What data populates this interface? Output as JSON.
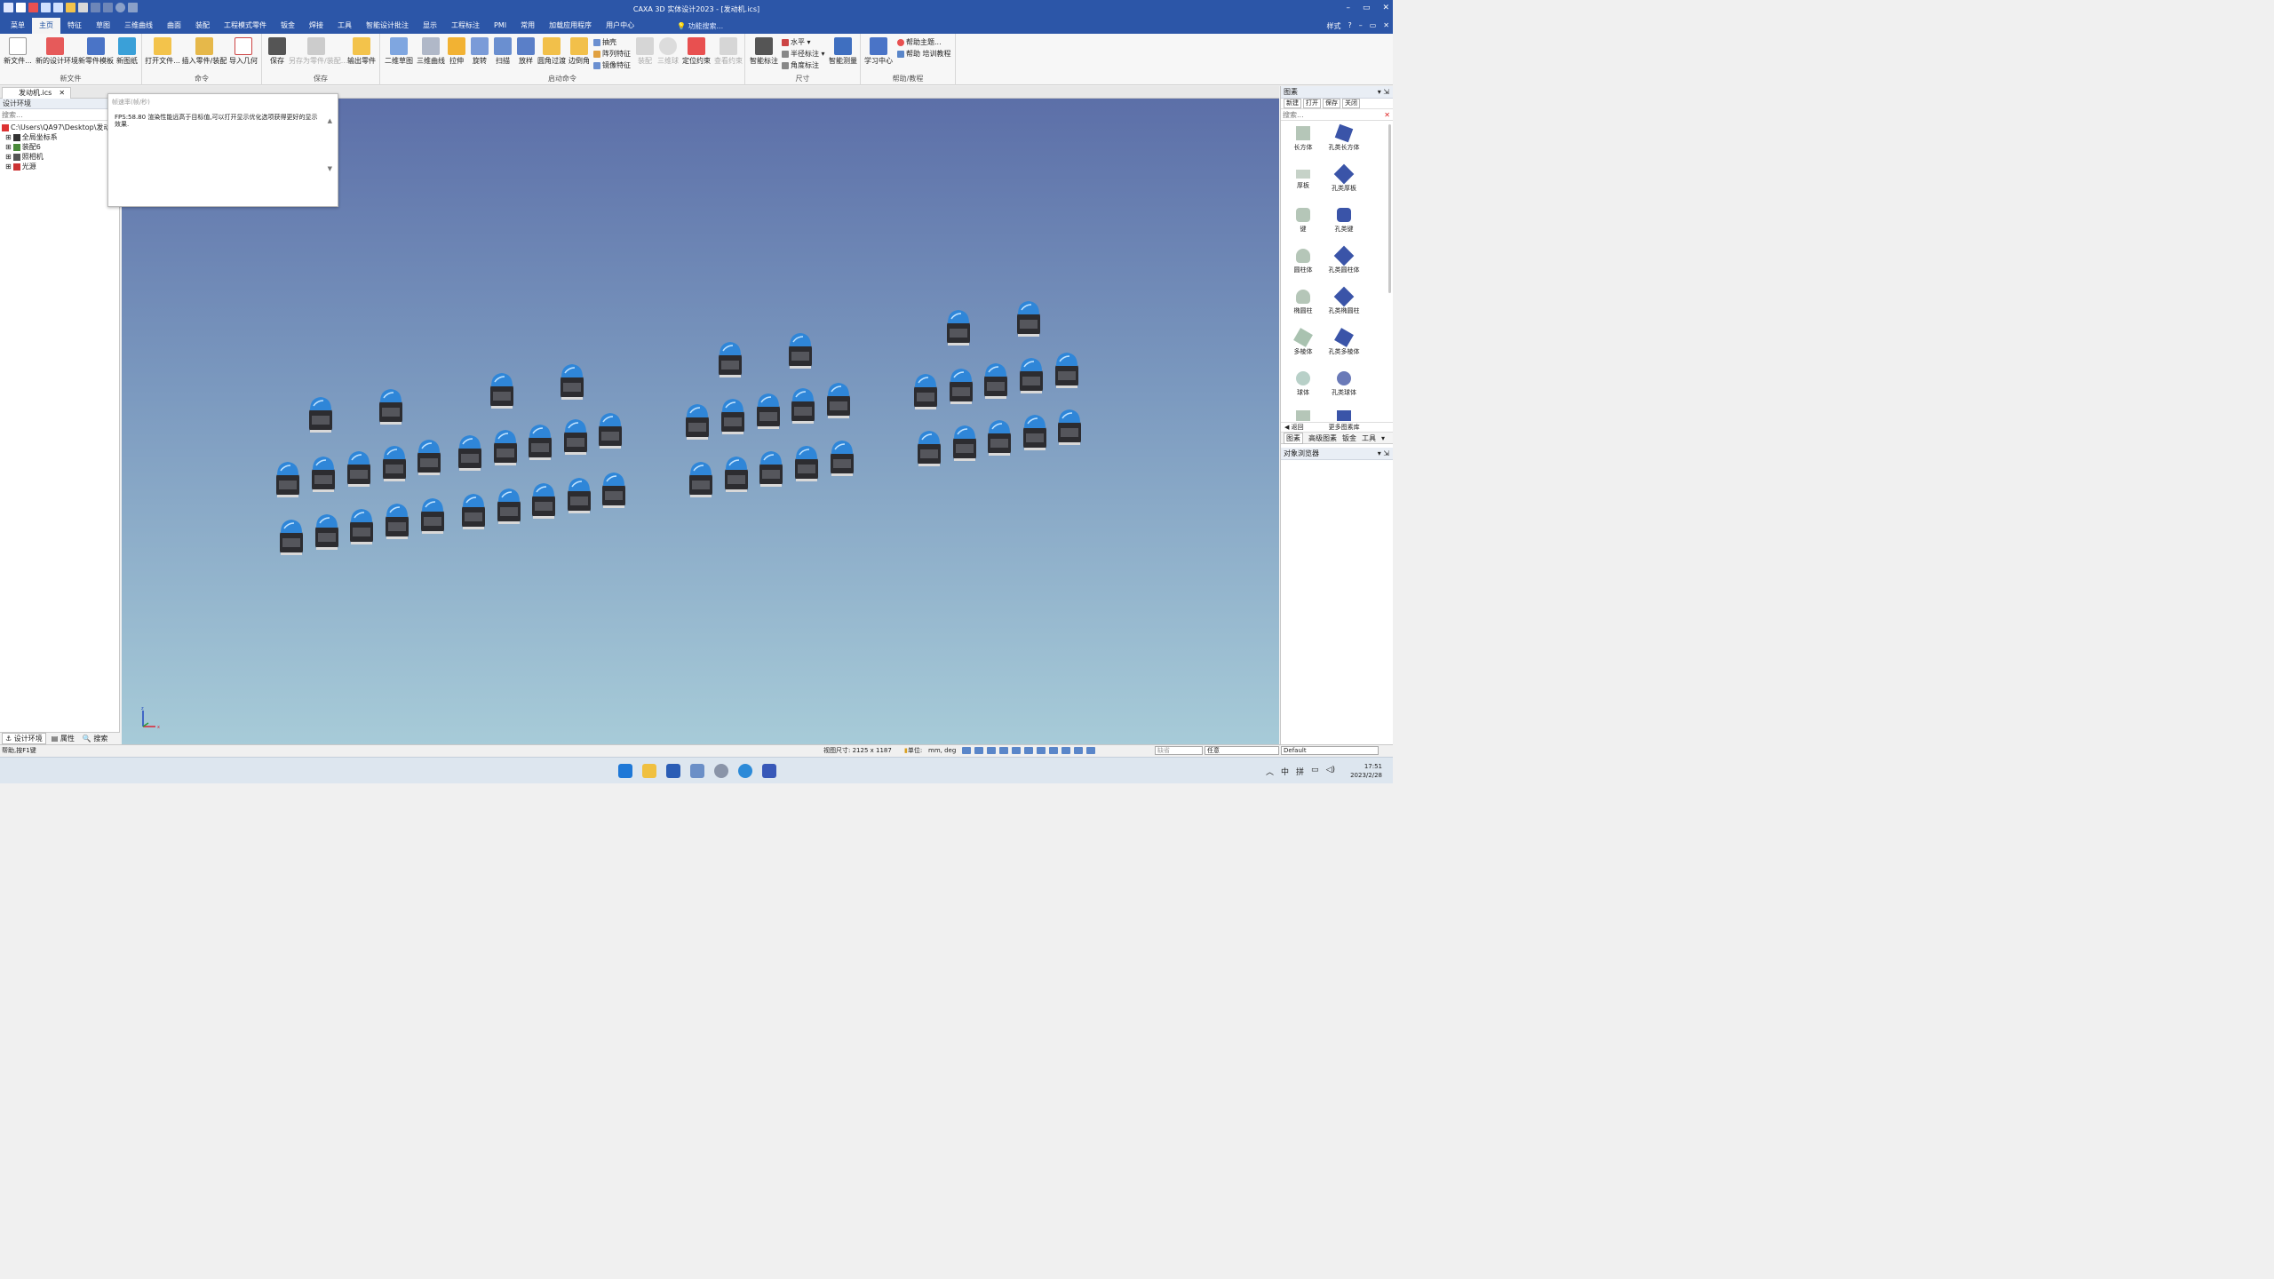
{
  "window": {
    "title": "CAXA 3D 实体设计2023 - [发动机.ics]",
    "controls": [
      "–",
      "▭",
      "✕"
    ]
  },
  "menu": {
    "tabs": [
      "菜单",
      "主页",
      "特征",
      "草图",
      "三维曲线",
      "曲面",
      "装配",
      "工程模式零件",
      "钣金",
      "焊接",
      "工具",
      "智能设计批注",
      "显示",
      "工程标注",
      "PMI",
      "常用",
      "加载应用程序",
      "用户中心"
    ],
    "active_tab": "主页",
    "function_search": "功能搜索...",
    "style_label": "样式"
  },
  "ribbon": {
    "groups": {
      "new_file": "新文件",
      "command": "命令",
      "save": "保存",
      "start_command": "启动命令",
      "dimension": "尺寸",
      "help": "帮助/教程"
    },
    "buttons": {
      "new_file": "新文件...",
      "new_design_env": "新的设计环境",
      "new_part_template": "新零件模板",
      "new_drawing": "新图纸",
      "open_file": "打开文件...",
      "insert_part": "插入零件/装配",
      "import_geometry": "导入几何",
      "save": "保存",
      "save_as_part": "另存为零件/装配...",
      "export_part": "输出零件",
      "sketch_2d": "二维草图",
      "curve_3d": "三维曲线",
      "extrude": "拉伸",
      "revolve": "旋转",
      "sweep": "扫描",
      "loft": "放样",
      "fillet": "圆角过渡",
      "chamfer": "边倒角",
      "shell": "抽壳",
      "array_feature": "阵列特征",
      "mirror_feature": "镜像特征",
      "assembly": "装配",
      "three_d_ball": "三维球",
      "position_constraint": "定位约束",
      "view_constraint": "查看约束",
      "smart_dimension": "智能标注",
      "horizontal": "水平",
      "radius_dimension": "半径标注",
      "angle_dimension": "角度标注",
      "smart_measure": "智能测量",
      "learning_center": "学习中心",
      "help_topics": "帮助主题...",
      "help_training": "帮助 培训教程"
    }
  },
  "doc_tab": "发动机.ics",
  "left_panel": {
    "title": "设计环境",
    "search_placeholder": "搜索...",
    "tree": [
      "C:\\Users\\QA97\\Desktop\\发动",
      "全局坐标系",
      "装配6",
      "照相机",
      "光源"
    ],
    "bottom_tabs": [
      "设计环境",
      "属性",
      "搜索"
    ]
  },
  "fps_panel": {
    "title": "帧速率(帧/秒)",
    "message": "FPS:58.80 渲染性能远高于目标值,可以打开显示优化选项获得更好的显示效果."
  },
  "right_panel": {
    "title": "图素",
    "tools": [
      "新建",
      "打开",
      "保存",
      "关闭"
    ],
    "search_placeholder": "搜索...",
    "shapes": [
      "长方体",
      "孔类长方体",
      "厚板",
      "孔类厚板",
      "键",
      "孔类键",
      "圆柱体",
      "孔类圆柱体",
      "椭圆柱",
      "孔类椭圆柱",
      "多棱体",
      "孔类多棱体",
      "球体",
      "孔类球体"
    ],
    "nav_back": "返回",
    "more_library": "更多图素库",
    "tabs": [
      "图素",
      "高级图素",
      "钣金",
      "工具"
    ],
    "object_browser": "对象浏览器"
  },
  "status": {
    "help": "帮助,按F1键",
    "view_size": "视图尺寸: 2125 x 1187",
    "unit_label": "单位:",
    "unit_value": "mm, deg",
    "dd_default_left": "缺省",
    "dd_any": "任意",
    "dd_default": "Default"
  },
  "taskbar": {
    "ime_1": "中",
    "ime_2": "拼",
    "time": "17:51",
    "date": "2023/2/28"
  },
  "colors": {
    "title_blue": "#2c56a8",
    "viewport_top": "#5c6fa8",
    "viewport_bottom": "#a7cbd8",
    "engine_blue": "#2f86d8"
  }
}
